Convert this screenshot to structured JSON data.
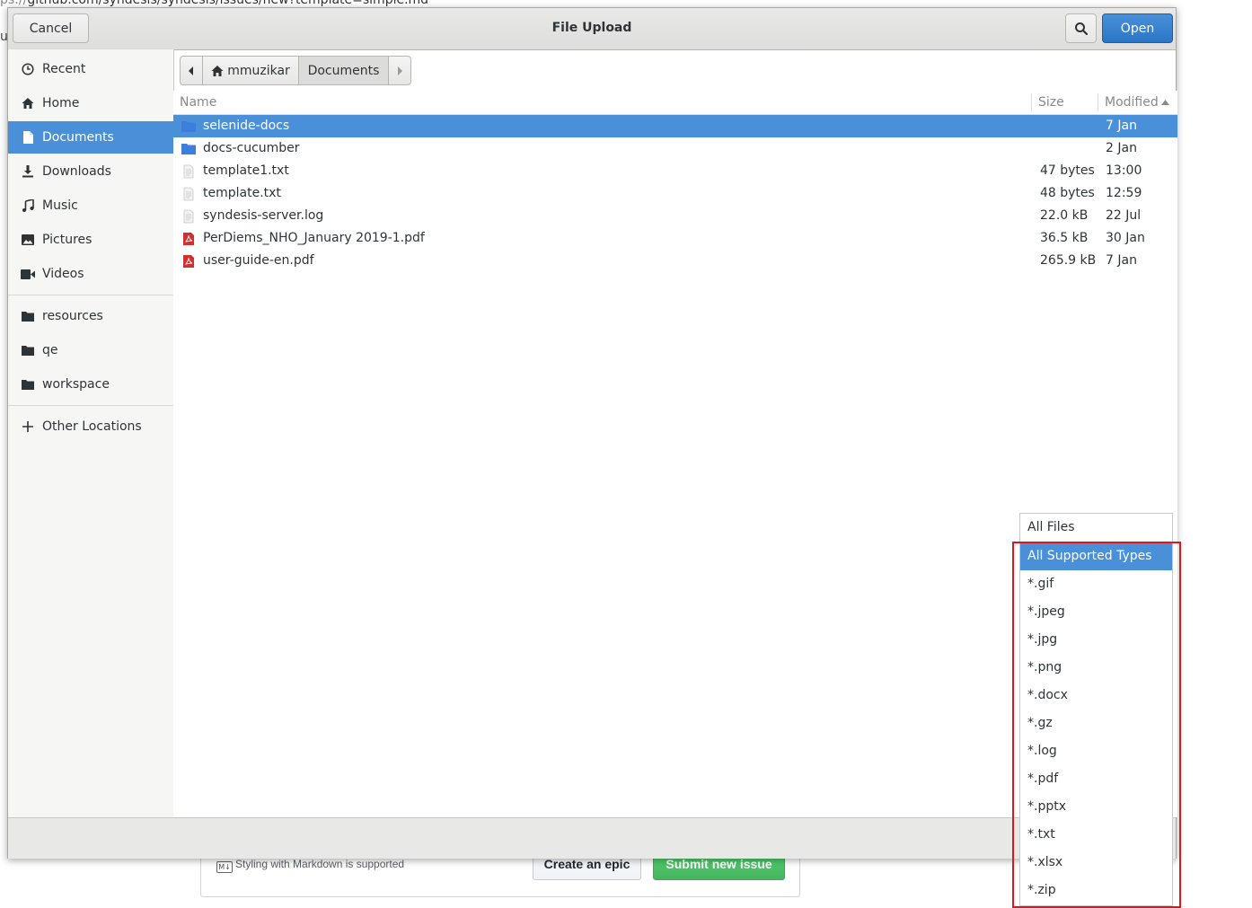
{
  "background": {
    "url_fragment_dim": "ps://",
    "url_fragment": "github.com/syndesis/syndesis/issues/new?template=simple.md",
    "left_char": "u",
    "markdown_note": "Styling with Markdown is supported",
    "markdown_icon_text": "M↓",
    "create_epic_label": "Create an epic",
    "submit_issue_label": "Submit new issue"
  },
  "dialog": {
    "title": "File Upload",
    "cancel_label": "Cancel",
    "open_label": "Open",
    "search_icon": "search-icon"
  },
  "sidebar": {
    "places": [
      {
        "label": "Recent",
        "icon": "clock-icon"
      },
      {
        "label": "Home",
        "icon": "home-icon"
      },
      {
        "label": "Documents",
        "icon": "document-icon",
        "selected": true
      },
      {
        "label": "Downloads",
        "icon": "download-icon"
      },
      {
        "label": "Music",
        "icon": "music-icon"
      },
      {
        "label": "Pictures",
        "icon": "picture-icon"
      },
      {
        "label": "Videos",
        "icon": "video-icon"
      }
    ],
    "bookmarks": [
      {
        "label": "resources",
        "icon": "folder-icon"
      },
      {
        "label": "qe",
        "icon": "folder-icon"
      },
      {
        "label": "workspace",
        "icon": "folder-icon"
      }
    ],
    "other": {
      "label": "Other Locations",
      "icon": "plus-icon"
    }
  },
  "pathbar": {
    "home_label": "mmuzikar",
    "current_label": "Documents"
  },
  "columns": {
    "name": "Name",
    "size": "Size",
    "modified": "Modified"
  },
  "files": [
    {
      "name": "selenide-docs",
      "size": "",
      "modified": "7 Jan",
      "type": "folder",
      "selected": true
    },
    {
      "name": "docs-cucumber",
      "size": "",
      "modified": "2 Jan",
      "type": "folder"
    },
    {
      "name": "template1.txt",
      "size": "47 bytes",
      "modified": "13:00",
      "type": "text"
    },
    {
      "name": "template.txt",
      "size": "48 bytes",
      "modified": "12:59",
      "type": "text"
    },
    {
      "name": "syndesis-server.log",
      "size": "22.0 kB",
      "modified": "22 Jul",
      "type": "text"
    },
    {
      "name": "PerDiems_NHO_January 2019-1.pdf",
      "size": "36.5 kB",
      "modified": "30 Jan",
      "type": "pdf"
    },
    {
      "name": "user-guide-en.pdf",
      "size": "265.9 kB",
      "modified": "7 Jan",
      "type": "pdf"
    }
  ],
  "filter_options": [
    "All Files",
    "All Supported Types",
    "*.gif",
    "*.jpeg",
    "*.jpg",
    "*.png",
    "*.docx",
    "*.gz",
    "*.log",
    "*.pdf",
    "*.pptx",
    "*.txt",
    "*.xlsx",
    "*.zip"
  ],
  "filter_selected": "All Supported Types",
  "colors": {
    "accent": "#4a90d9",
    "highlight_box": "#e0161c",
    "folder": "#3d7ddb",
    "pdf": "#d32f2f"
  }
}
